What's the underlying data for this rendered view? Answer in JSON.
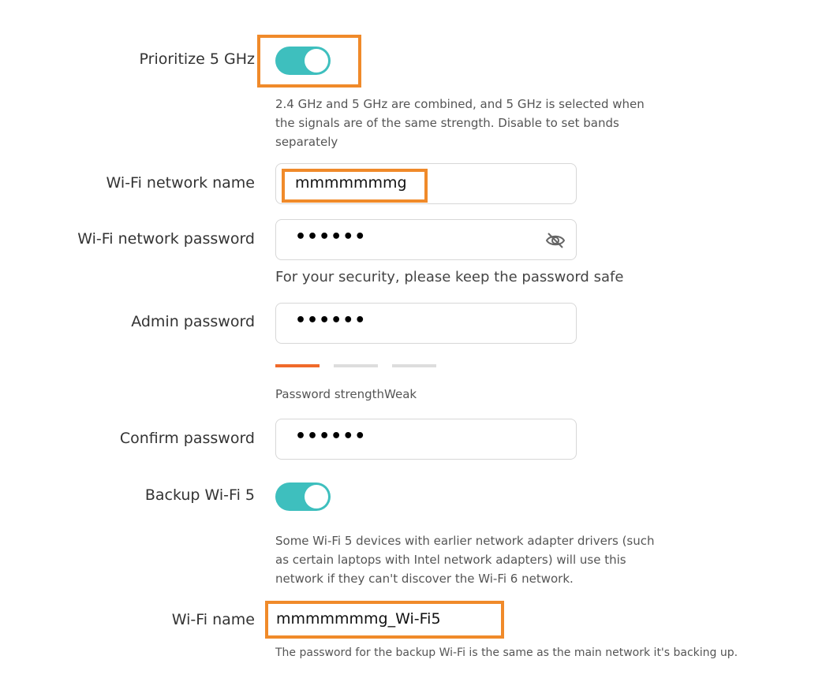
{
  "prioritize": {
    "label": "Prioritize 5 GHz",
    "enabled": true,
    "help_lines": [
      "2.4 GHz and 5 GHz are combined, and 5 GHz is selected when",
      "the signals are of the same strength. Disable to set bands",
      "separately"
    ]
  },
  "wifi_name": {
    "label": "Wi-Fi network name",
    "value": "mmmmmmmg"
  },
  "wifi_password": {
    "label": "Wi-Fi network password",
    "value": "••••••",
    "help": "For your security, please keep the password safe"
  },
  "admin_password": {
    "label": "Admin password",
    "value": "••••••",
    "strength_text": "Password strengthWeak",
    "strength_level": 1,
    "strength_colors": [
      "#f06a2a",
      "#dddddd",
      "#dddddd"
    ]
  },
  "confirm_password": {
    "label": "Confirm password",
    "value": "••••••"
  },
  "backup": {
    "label": "Backup Wi-Fi 5",
    "enabled": true,
    "help_lines": [
      "Some Wi-Fi 5 devices with earlier network adapter drivers (such",
      "as certain laptops with Intel network adapters) will use this",
      "network if they can't discover the Wi-Fi 6 network."
    ]
  },
  "backup_name": {
    "label": "Wi-Fi name",
    "value": "mmmmmmmg_Wi-Fi5",
    "help": "The password for the backup Wi-Fi is the same as the main network it's backing up."
  },
  "colors": {
    "toggle_on": "#3ebfbe",
    "highlight": "#f08a2a"
  },
  "icons": {
    "password_visibility": "eye-slash-icon"
  }
}
